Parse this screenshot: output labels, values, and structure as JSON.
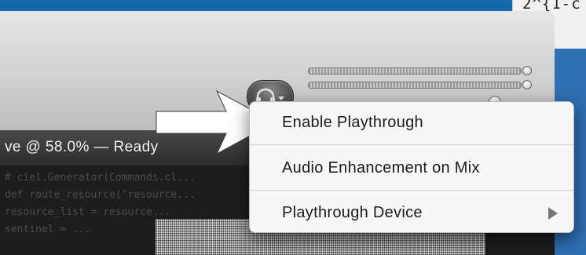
{
  "background_window": {
    "text": "2^{1-c"
  },
  "status_bar": {
    "text": "ve @ 58.0% — Ready"
  },
  "code_lines": [
    "# ciel.Generator(Commands.cl...",
    "def route_resource(\"resource...",
    "    resource_list = resource...",
    "    sentinel = ..."
  ],
  "toolbar": {
    "headphones_button": "headphones-menu"
  },
  "context_menu": {
    "items": [
      {
        "label": "Enable Playthrough",
        "has_submenu": false
      },
      {
        "label": "Audio Enhancement on Mix",
        "has_submenu": false
      },
      {
        "label": "Playthrough Device",
        "has_submenu": true
      }
    ]
  },
  "colors": {
    "menu_bg": "#f7f7f7",
    "arrow": "#ffffff",
    "status_bar": "#333333",
    "desktop": "#1567ab"
  }
}
